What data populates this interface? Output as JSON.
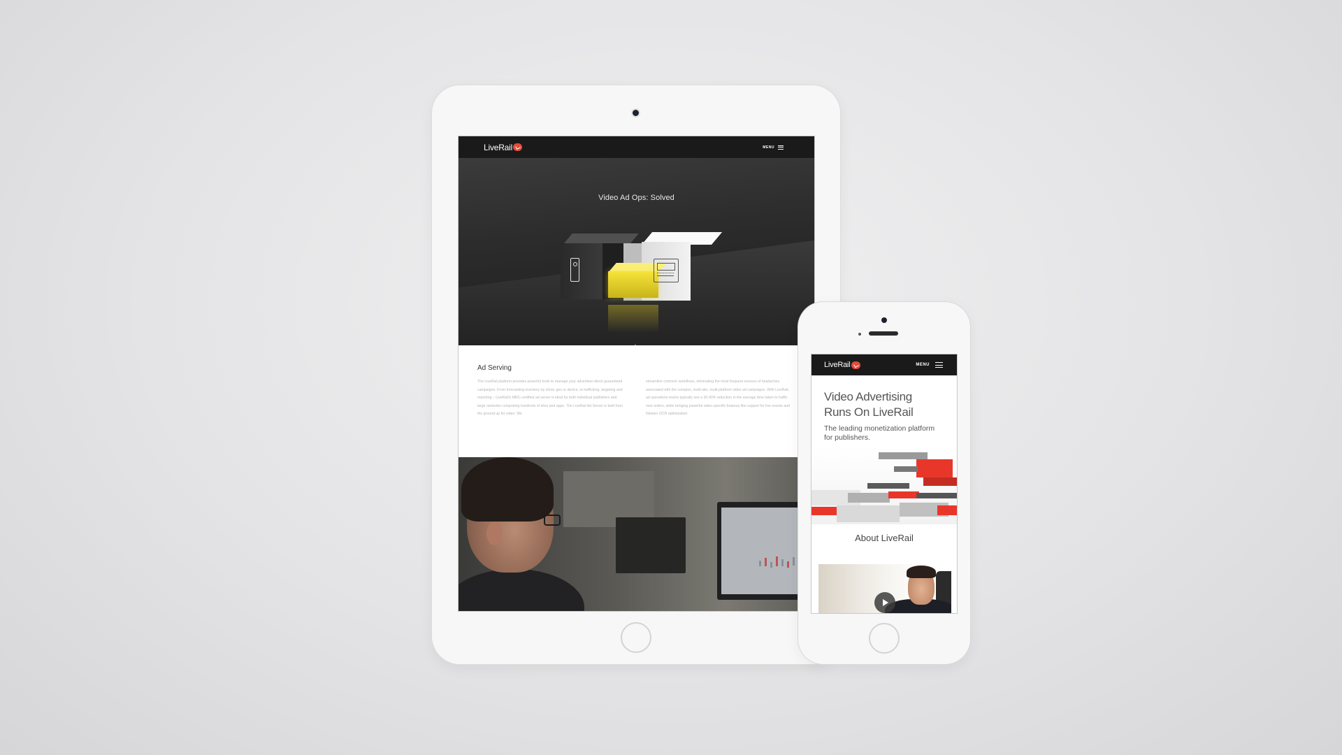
{
  "tablet": {
    "nav": {
      "logo": "LiveRail",
      "menu_label": "MENU"
    },
    "hero": {
      "title": "Video Ad Ops: Solved"
    },
    "section": {
      "heading": "Ad Serving",
      "col1": "The LiveRail platform provides powerful tools to manage your advertiser-direct guaranteed campaigns. From forecasting inventory by show, geo or device, to trafficking, targeting and reporting – LiveRail's MRC-certified ad server is ideal for both individual publishers and large networks comprising hundreds of sites and apps. The LiveRail Ad Server is built from the ground up for video. We",
      "col2": "streamline common workflows, eliminating the most frequent sources of headaches associated with the complex, multi-site, multi-platform video ad campaigns. With LiveRail, ad operations teams typically see a 30-40% reduction in the average time taken to traffic new orders, while bringing powerful video-specific features like support for live events and Nielsen OCR optimization."
    }
  },
  "phone": {
    "nav": {
      "logo": "LiveRail",
      "menu_label": "MENU"
    },
    "hero": {
      "title_line1": "Video Advertising",
      "title_line2": "Runs On LiveRail",
      "subtitle_line1": "The leading monetization platform",
      "subtitle_line2": "for publishers."
    },
    "about": {
      "heading": "About LiveRail"
    }
  },
  "colors": {
    "background": "#e4e4e6",
    "device": "#f7f7f7",
    "nav": "#1a1a1a",
    "brand_red": "#e34b3b",
    "accent_yellow": "#f6e33a"
  }
}
